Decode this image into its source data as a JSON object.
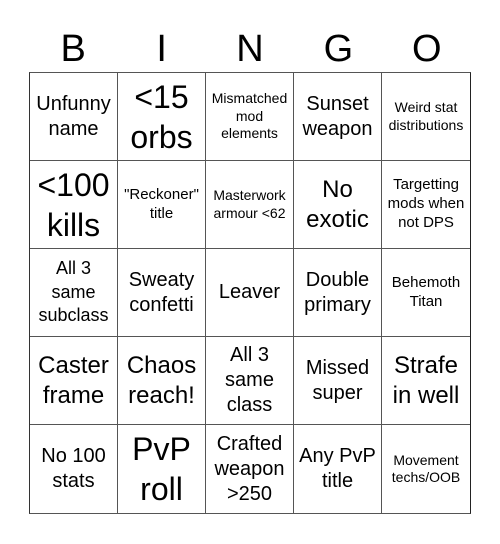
{
  "header": {
    "letters": [
      "B",
      "I",
      "N",
      "G",
      "O"
    ]
  },
  "board": {
    "cells": [
      [
        "Unfunny name",
        "<15 orbs",
        "Mismatched mod elements",
        "Sunset weapon",
        "Weird stat distributions"
      ],
      [
        "<100 kills",
        "\"Reckoner\" title",
        "Masterwork armour <62",
        "No exotic",
        "Targetting mods when not DPS"
      ],
      [
        "All 3 same subclass",
        "Sweaty confetti",
        "Leaver",
        "Double primary",
        "Behemoth Titan"
      ],
      [
        "Caster frame",
        "Chaos reach!",
        "All 3 same class",
        "Missed super",
        "Strafe in well"
      ],
      [
        "No 100 stats",
        "PvP roll",
        "Crafted weapon >250",
        "Any PvP title",
        "Movement techs/OOB"
      ]
    ]
  }
}
